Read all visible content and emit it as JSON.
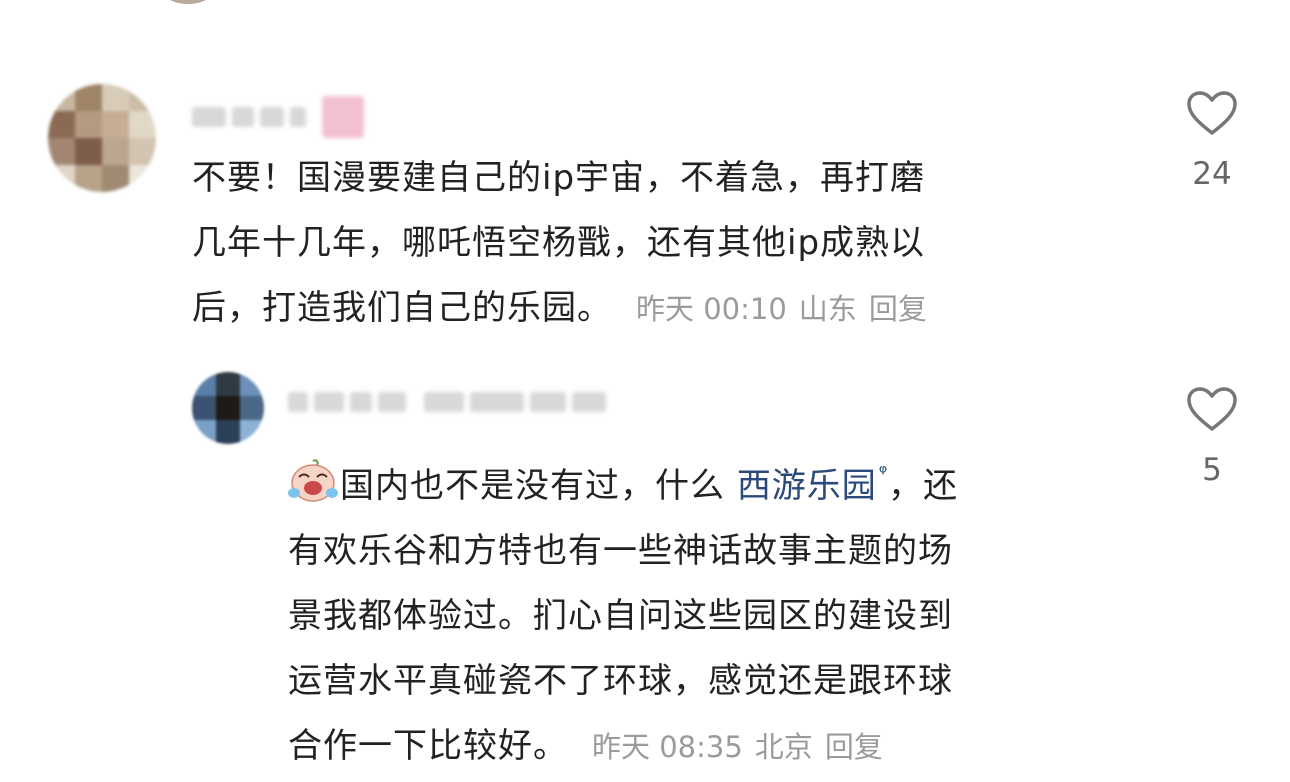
{
  "comments": [
    {
      "username": "",
      "text_lines": [
        "不要！国漫要建自己的ip宇宙，不着急，再打磨",
        "几年十几年，哪吒悟空杨戬，还有其他ip成熟以",
        "后，打造我们自己的乐园。"
      ],
      "time": "昨天 00:10",
      "location": "山东",
      "reply_label": "回复",
      "likes": "24",
      "like_icon": "heart-outline-icon"
    },
    {
      "username": "",
      "emoji": "laughing-crying-face-emoji",
      "text_prefix": "国内也不是没有过，什么 ",
      "link_text": "西游乐园",
      "link_icon": "search-icon",
      "text_suffix": "，还",
      "text_lines": [
        "有欢乐谷和方特也有一些神话故事主题的场",
        "景我都体验过。扪心自问这些园区的建设到",
        "运营水平真碰瓷不了环球，感觉还是跟环球",
        "合作一下比较好。"
      ],
      "time": "昨天 08:35",
      "location": "北京",
      "reply_label": "回复",
      "likes": "5",
      "like_icon": "heart-outline-icon"
    }
  ],
  "colors": {
    "text": "#222222",
    "meta": "#9b9b9b",
    "link": "#2b4a7a",
    "like_count": "#666666"
  }
}
